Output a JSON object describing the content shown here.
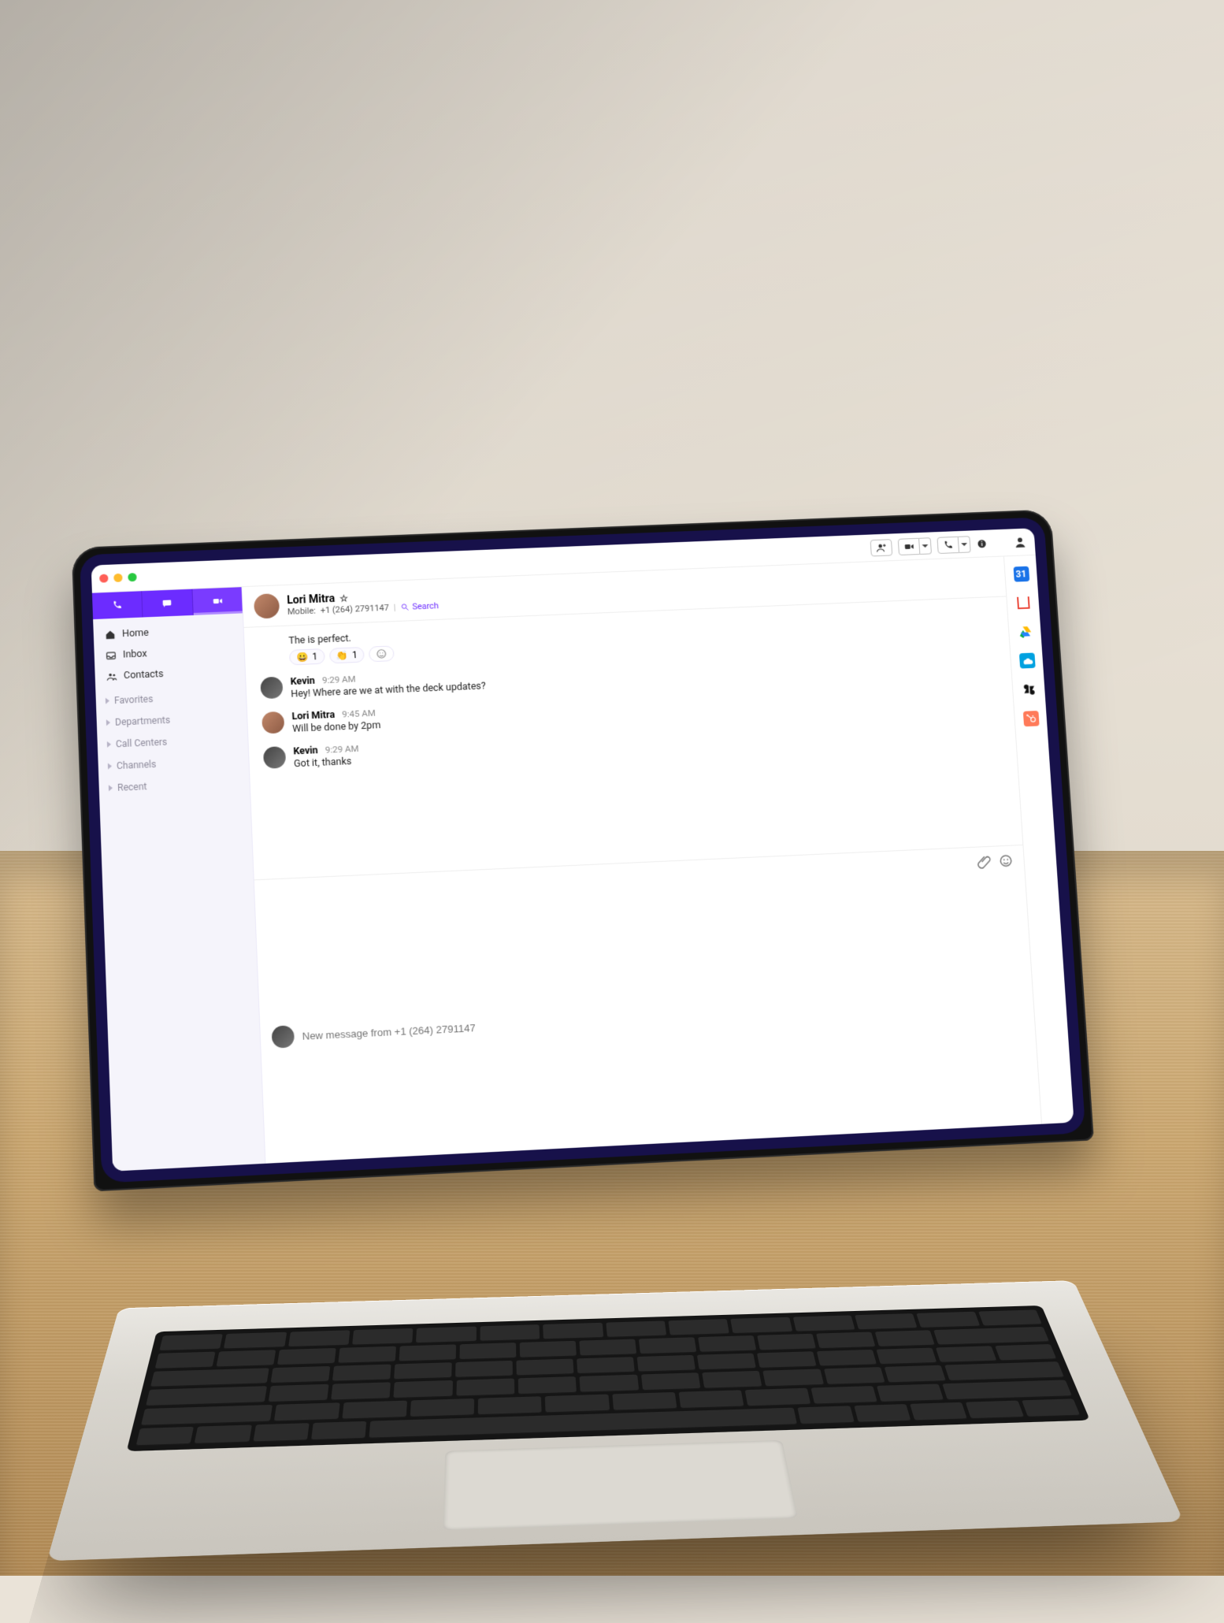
{
  "titlebar": {
    "actions": {
      "add_person": "add-person",
      "video": "video",
      "call": "call",
      "info": "info",
      "profile": "profile"
    }
  },
  "sidebar": {
    "tabs": {
      "call": "call",
      "chat": "chat",
      "meet": "meet"
    },
    "nav": {
      "home": "Home",
      "inbox": "Inbox",
      "contacts": "Contacts"
    },
    "sections": {
      "favorites": "Favorites",
      "departments": "Departments",
      "call_centers": "Call Centers",
      "channels": "Channels",
      "recent": "Recent"
    }
  },
  "conversation": {
    "contact_name": "Lori Mitra",
    "subtitle_prefix": "Mobile:",
    "subtitle_number": "+1 (264) 2791147",
    "search_label": "Search",
    "reaction_preface": "The is perfect.",
    "reactions": [
      {
        "emoji": "😀",
        "count": "1"
      },
      {
        "emoji": "👏",
        "count": "1"
      }
    ],
    "messages": [
      {
        "name": "Kevin",
        "time": "9:29 AM",
        "text": "Hey! Where are we at with the deck updates?"
      },
      {
        "name": "Lori Mitra",
        "time": "9:45 AM",
        "text": "Will be done by 2pm"
      },
      {
        "name": "Kevin",
        "time": "9:29 AM",
        "text": "Got it, thanks"
      }
    ],
    "composer_placeholder": "New message from +1 (264) 2791147"
  },
  "integrations": {
    "gcal": "31",
    "gmail": "M",
    "gdrive": "drive",
    "salesforce": "cloud",
    "zendesk": "zendesk",
    "hubspot": "hubspot"
  }
}
